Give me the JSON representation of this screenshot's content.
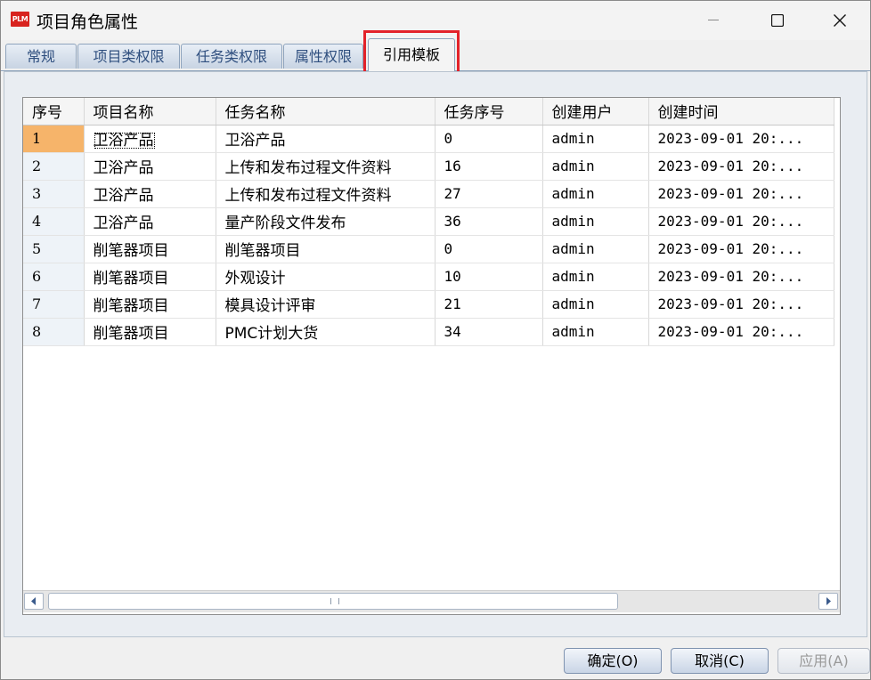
{
  "window": {
    "app_icon_text": "PLM",
    "title": "项目角色属性"
  },
  "tabs": [
    {
      "label": "常规",
      "active": false
    },
    {
      "label": "项目类权限",
      "active": false
    },
    {
      "label": "任务类权限",
      "active": false
    },
    {
      "label": "属性权限",
      "active": false
    },
    {
      "label": "引用模板",
      "active": true
    }
  ],
  "table": {
    "columns": [
      "序号",
      "项目名称",
      "任务名称",
      "任务序号",
      "创建用户",
      "创建时间"
    ],
    "rows": [
      {
        "index": "1",
        "project": "卫浴产品",
        "task": "卫浴产品",
        "task_no": "0",
        "user": "admin",
        "created": "2023-09-01 20:..."
      },
      {
        "index": "2",
        "project": "卫浴产品",
        "task": "上传和发布过程文件资料",
        "task_no": "16",
        "user": "admin",
        "created": "2023-09-01 20:..."
      },
      {
        "index": "3",
        "project": "卫浴产品",
        "task": "上传和发布过程文件资料",
        "task_no": "27",
        "user": "admin",
        "created": "2023-09-01 20:..."
      },
      {
        "index": "4",
        "project": "卫浴产品",
        "task": "量产阶段文件发布",
        "task_no": "36",
        "user": "admin",
        "created": "2023-09-01 20:..."
      },
      {
        "index": "5",
        "project": "削笔器项目",
        "task": "削笔器项目",
        "task_no": "0",
        "user": "admin",
        "created": "2023-09-01 20:..."
      },
      {
        "index": "6",
        "project": "削笔器项目",
        "task": "外观设计",
        "task_no": "10",
        "user": "admin",
        "created": "2023-09-01 20:..."
      },
      {
        "index": "7",
        "project": "削笔器项目",
        "task": "模具设计评审",
        "task_no": "21",
        "user": "admin",
        "created": "2023-09-01 20:..."
      },
      {
        "index": "8",
        "project": "削笔器项目",
        "task": "PMC计划大货",
        "task_no": "34",
        "user": "admin",
        "created": "2023-09-01 20:..."
      }
    ]
  },
  "scrollbar": {
    "grip": "⁞"
  },
  "buttons": {
    "ok": "确定(O)",
    "cancel": "取消(C)",
    "apply": "应用(A)"
  },
  "colors": {
    "highlight": "#e3222a",
    "selected_row_index": "#f6b46a"
  }
}
